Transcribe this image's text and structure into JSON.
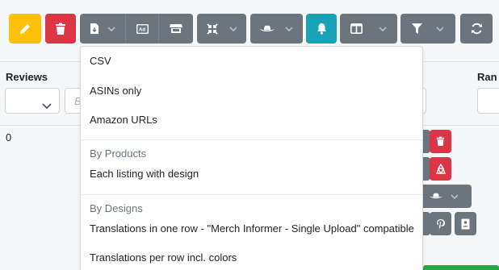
{
  "toolbar": {
    "edit_icon": "pencil-icon",
    "delete_icon": "trash-icon",
    "export_icon": "file-export-icon",
    "ad_icon": "ad-icon",
    "store_icon": "store-icon",
    "compress_icon": "compress-icon",
    "hat_icon": "cowboy-hat-icon",
    "bell_icon": "bell-icon",
    "columns_icon": "columns-icon",
    "filter_icon": "filter-icon",
    "refresh_icon": "sync-icon"
  },
  "table": {
    "headers": {
      "reviews": "Reviews",
      "rank_partial": "Ran"
    },
    "filter_placeholder_partial": "B",
    "row": {
      "reviews_value": "0"
    }
  },
  "dropdown": {
    "items_top": [
      "CSV",
      "ASINs only",
      "Amazon URLs"
    ],
    "group_products": {
      "header": "By Products",
      "items": [
        "Each listing with design"
      ]
    },
    "group_designs": {
      "header": "By Designs",
      "items": [
        "Translations in one row - \"Merch Informer - Single Upload\" compatible",
        "Translations per row incl. colors"
      ]
    }
  },
  "colors": {
    "warning": "#ffc107",
    "danger": "#dc3545",
    "secondary": "#6c757d",
    "info": "#17a2b8",
    "success": "#28a745"
  }
}
